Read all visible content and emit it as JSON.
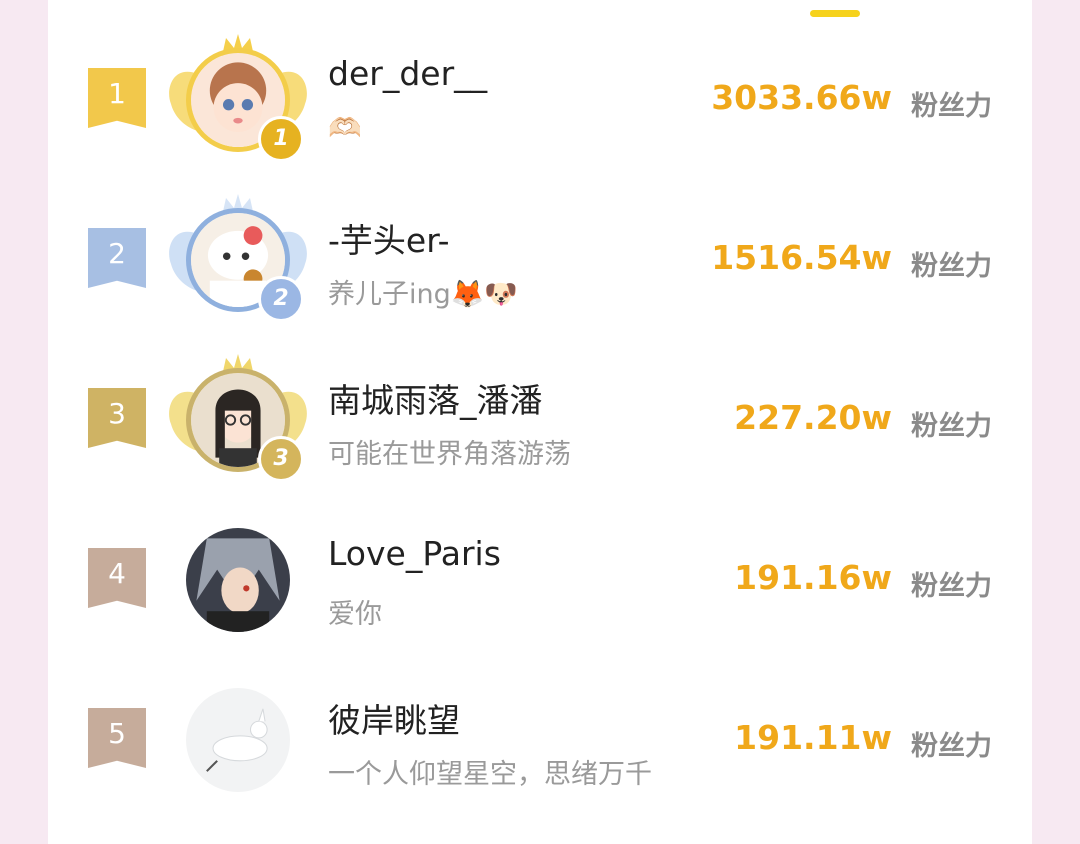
{
  "ranking": [
    {
      "rank": "1",
      "name": "der_der__",
      "signature": "🫶🏻",
      "score": "3033.66w",
      "unit": "粉丝力",
      "medal": "1",
      "rank_color": "#f2c84b",
      "medal_color": "#e6b221"
    },
    {
      "rank": "2",
      "name": "-芋头er-",
      "signature": "养儿子ing🦊🐶",
      "score": "1516.54w",
      "unit": "粉丝力",
      "medal": "2",
      "rank_color": "#a7bfe3",
      "medal_color": "#9bb7e4"
    },
    {
      "rank": "3",
      "name": "南城雨落_潘潘",
      "signature": "可能在世界角落游荡",
      "score": "227.20w",
      "unit": "粉丝力",
      "medal": "3",
      "rank_color": "#cfb364",
      "medal_color": "#d4b55c"
    },
    {
      "rank": "4",
      "name": "Love_Paris",
      "signature": "爱你",
      "score": "191.16w",
      "unit": "粉丝力",
      "rank_color": "#c6ac9b"
    },
    {
      "rank": "5",
      "name": "彼岸眺望",
      "signature": "一个人仰望星空，思绪万千",
      "score": "191.11w",
      "unit": "粉丝力",
      "rank_color": "#c6ac9b"
    }
  ]
}
